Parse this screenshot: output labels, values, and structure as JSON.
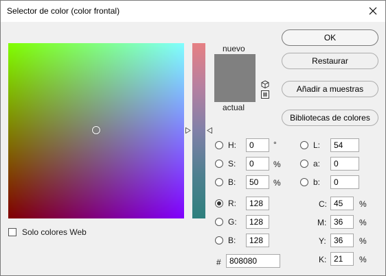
{
  "window": {
    "title": "Selector de color (color frontal)"
  },
  "preview": {
    "new_label": "nuevo",
    "current_label": "actual",
    "new_color": "#808080",
    "current_color": "#808080"
  },
  "buttons": {
    "ok": "OK",
    "reset": "Restaurar",
    "add_swatches": "Añadir a muestras",
    "libraries": "Bibliotecas de colores"
  },
  "hsb": {
    "h": {
      "label": "H:",
      "value": "0",
      "unit": "°"
    },
    "s": {
      "label": "S:",
      "value": "0",
      "unit": "%"
    },
    "b": {
      "label": "B:",
      "value": "50",
      "unit": "%"
    }
  },
  "rgb": {
    "r": {
      "label": "R:",
      "value": "128"
    },
    "g": {
      "label": "G:",
      "value": "128"
    },
    "b": {
      "label": "B:",
      "value": "128"
    },
    "selected": "R"
  },
  "lab": {
    "l": {
      "label": "L:",
      "value": "54"
    },
    "a": {
      "label": "a:",
      "value": "0"
    },
    "b": {
      "label": "b:",
      "value": "0"
    }
  },
  "cmyk": {
    "c": {
      "label": "C:",
      "value": "45",
      "unit": "%"
    },
    "m": {
      "label": "M:",
      "value": "36",
      "unit": "%"
    },
    "y": {
      "label": "Y:",
      "value": "36",
      "unit": "%"
    },
    "k": {
      "label": "K:",
      "value": "21",
      "unit": "%"
    }
  },
  "hex": {
    "label": "#",
    "value": "808080"
  },
  "web_only": {
    "label": "Solo colores Web",
    "checked": false
  },
  "icons": {
    "close": "close-icon",
    "cube": "cube-icon",
    "websafe": "websafe-square-icon"
  }
}
